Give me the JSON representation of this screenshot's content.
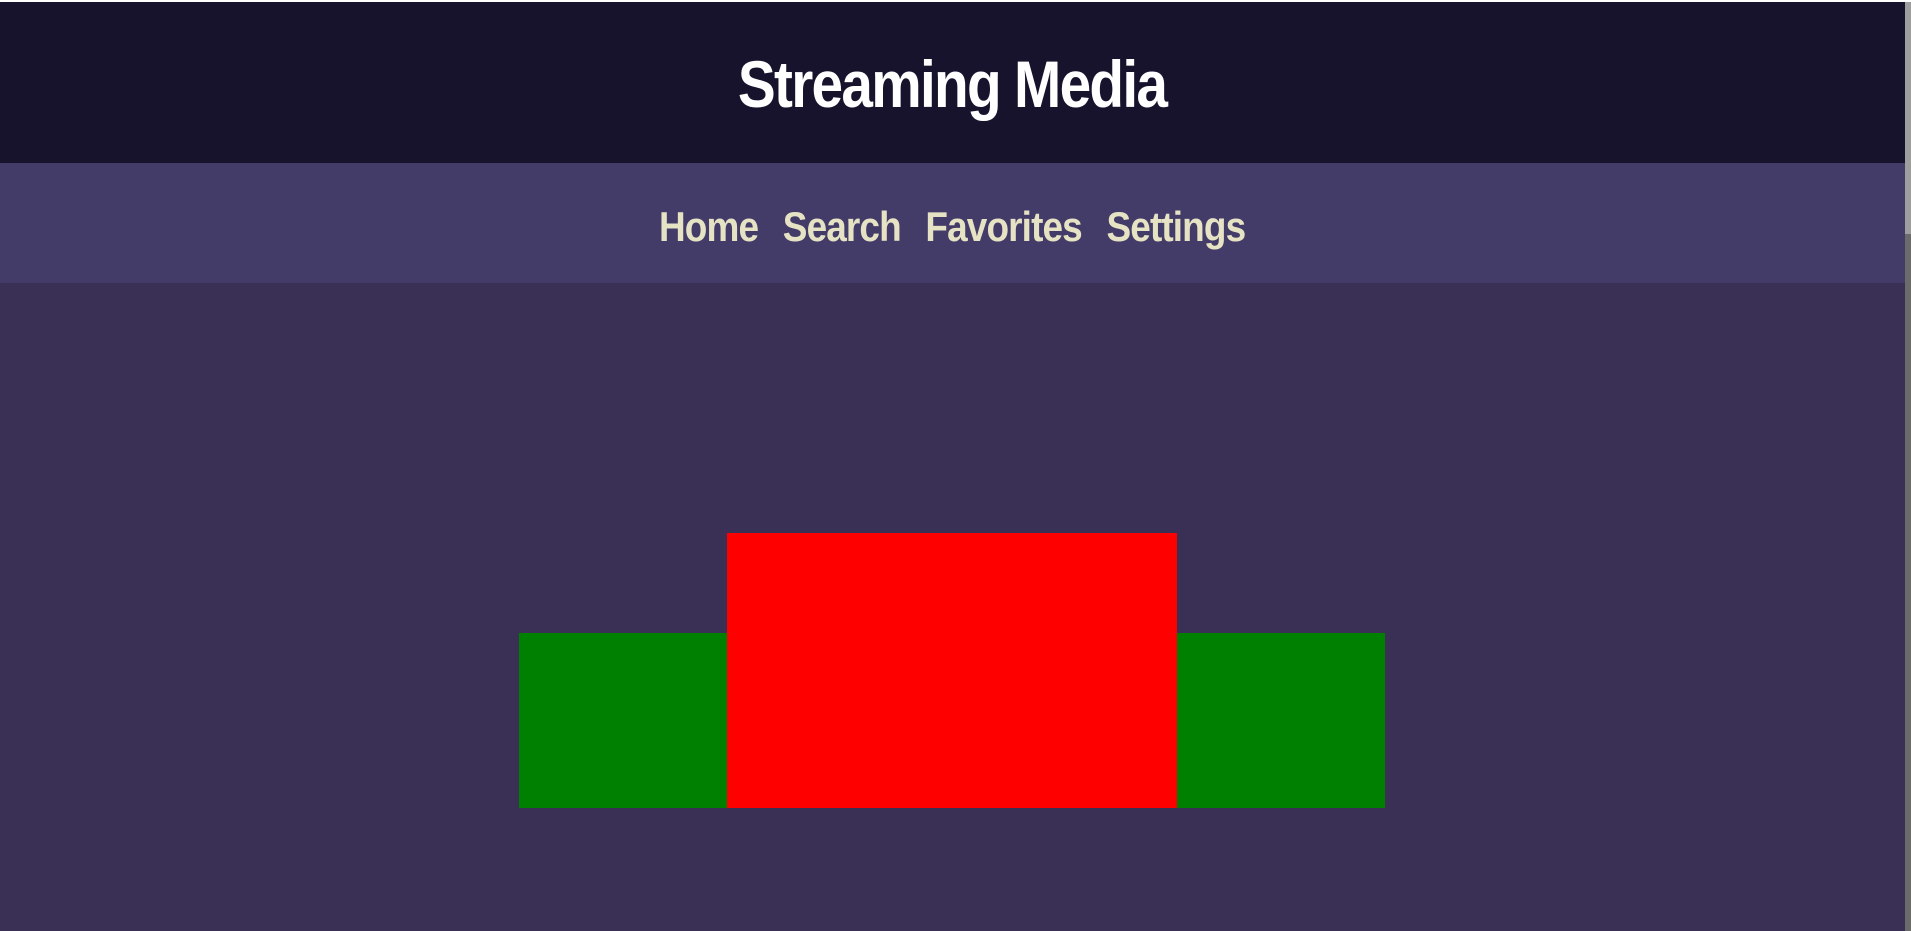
{
  "header": {
    "title": "Streaming Media"
  },
  "nav": {
    "items": [
      {
        "label": "Home"
      },
      {
        "label": "Search"
      },
      {
        "label": "Favorites"
      },
      {
        "label": "Settings"
      }
    ]
  },
  "main": {
    "blocks": [
      {
        "color": "#008000"
      },
      {
        "color": "#ff0000"
      },
      {
        "color": "#008000"
      }
    ]
  },
  "colors": {
    "header_bg": "#18132c",
    "nav_bg": "#433b68",
    "main_bg": "#3a2f55",
    "title_text": "#ffffff",
    "nav_text": "#e6e2c4"
  }
}
